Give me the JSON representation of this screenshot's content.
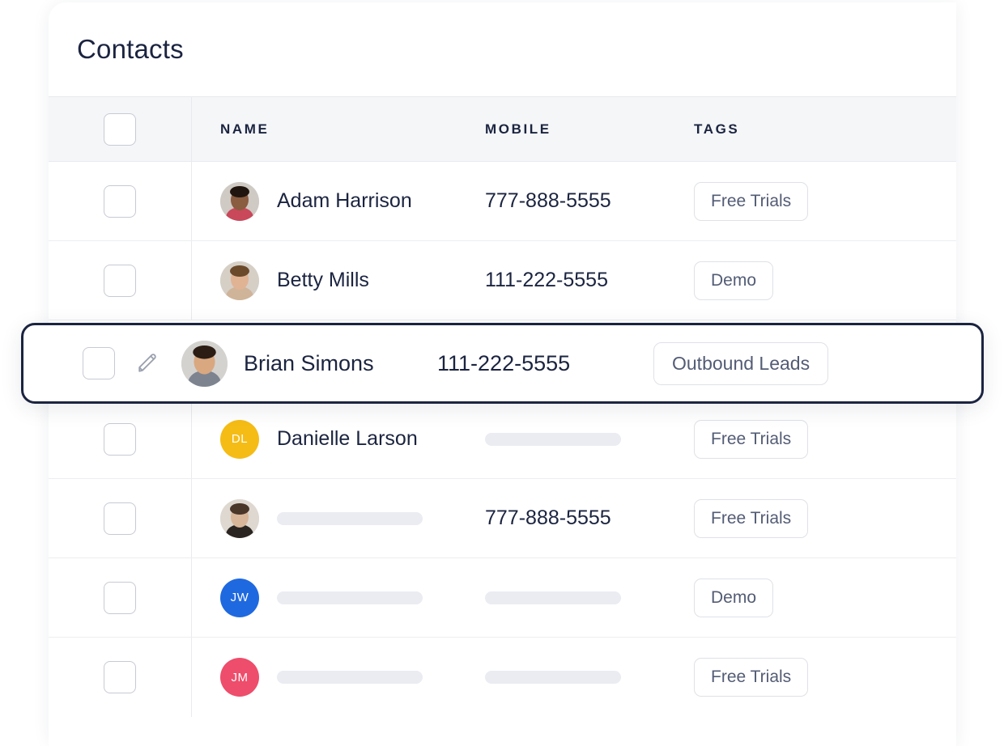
{
  "card": {
    "title": "Contacts"
  },
  "table": {
    "columns": [
      {
        "key": "check",
        "label": ""
      },
      {
        "key": "name",
        "label": "NAME"
      },
      {
        "key": "mobile",
        "label": "MOBILE"
      },
      {
        "key": "tags",
        "label": "TAGS"
      }
    ],
    "select_all_checkbox": "unchecked",
    "rows": [
      {
        "checkbox": "unchecked",
        "avatar_type": "photo",
        "avatar_initials": "",
        "avatar_color": "#b9a79a",
        "name": "Adam Harrison",
        "name_hidden": false,
        "mobile": "777-888-5555",
        "mobile_hidden": false,
        "tag": "Free Trials"
      },
      {
        "checkbox": "unchecked",
        "avatar_type": "photo",
        "avatar_initials": "",
        "avatar_color": "#c9a88e",
        "name": "Betty Mills",
        "name_hidden": false,
        "mobile": "111-222-5555",
        "mobile_hidden": false,
        "tag": "Demo"
      },
      {
        "checkbox": "unchecked",
        "avatar_type": "photo",
        "avatar_initials": "",
        "avatar_color": "#9a8b82",
        "name": "Brian Simons",
        "name_hidden": false,
        "mobile": "111-222-5555",
        "mobile_hidden": false,
        "tag": "Outbound Leads",
        "focused": true,
        "edit_icon": "pencil-icon"
      },
      {
        "checkbox": "unchecked",
        "avatar_type": "initials",
        "avatar_initials": "DL",
        "avatar_color": "#f5bc16",
        "name": "Danielle Larson",
        "name_hidden": false,
        "mobile": "",
        "mobile_hidden": true,
        "tag": "Free Trials"
      },
      {
        "checkbox": "unchecked",
        "avatar_type": "photo",
        "avatar_initials": "",
        "avatar_color": "#cfc3b4",
        "name": "",
        "name_hidden": true,
        "mobile": "777-888-5555",
        "mobile_hidden": false,
        "tag": "Free Trials"
      },
      {
        "checkbox": "unchecked",
        "avatar_type": "initials",
        "avatar_initials": "JW",
        "avatar_color": "#1f69e0",
        "name": "",
        "name_hidden": true,
        "mobile": "",
        "mobile_hidden": true,
        "tag": "Demo"
      },
      {
        "checkbox": "unchecked",
        "avatar_type": "initials",
        "avatar_initials": "JM",
        "avatar_color": "#ee4d6b",
        "name": "",
        "name_hidden": true,
        "mobile": "",
        "mobile_hidden": true,
        "tag": "Free Trials"
      }
    ]
  },
  "colors": {
    "text_primary": "#1b2440",
    "text_muted": "#535c75",
    "header_bg": "#f5f6f8",
    "border": "#e9eaee",
    "focus_border": "#1b2440",
    "skeleton": "#eaecf2"
  }
}
